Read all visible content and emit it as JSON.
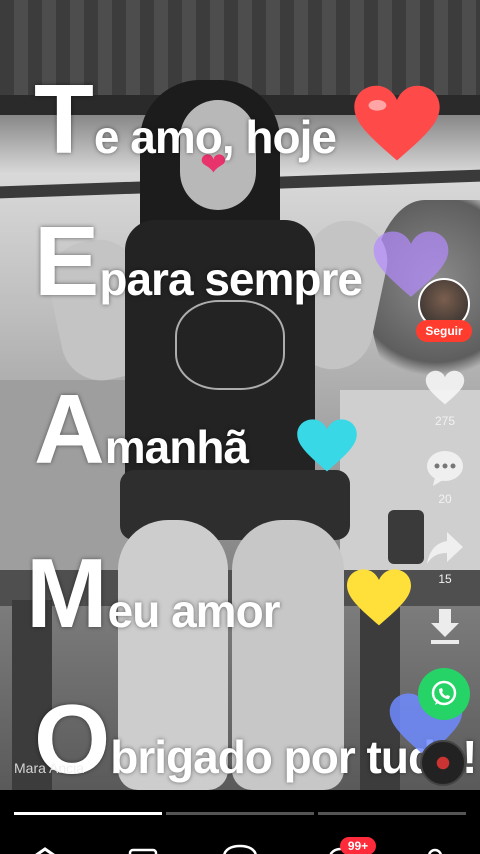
{
  "overlay_lines": [
    {
      "initial": "T",
      "rest": "e amo, hoje"
    },
    {
      "initial": "E",
      "rest": "para sempre"
    },
    {
      "initial": "A",
      "rest": "manhã"
    },
    {
      "initial": "M",
      "rest": "eu amor"
    },
    {
      "initial": "O",
      "rest": "brigado por tudo!"
    }
  ],
  "creator": {
    "follow_label": "Seguir",
    "username": "Mara Ancia"
  },
  "actions": {
    "likes": "275",
    "comments": "20",
    "shares": "15"
  },
  "progress": {
    "segments": 3,
    "active": 1
  },
  "nav": {
    "notifications_badge": "99+"
  },
  "colors": {
    "follow": "#ff3c2e",
    "whatsapp": "#25d366",
    "badge": "#ff2a3a",
    "heart_red": "#ff4a4a",
    "heart_purple": "#b58cff",
    "heart_cyan": "#38d8e6",
    "heart_yellow": "#ffe03a",
    "heart_blue": "#6f8bff"
  },
  "icons": [
    "heart-icon",
    "comment-icon",
    "share-icon",
    "download-icon",
    "whatsapp-icon",
    "music-disc-icon",
    "home-icon",
    "friends-icon",
    "create-icon",
    "inbox-icon",
    "profile-icon"
  ]
}
